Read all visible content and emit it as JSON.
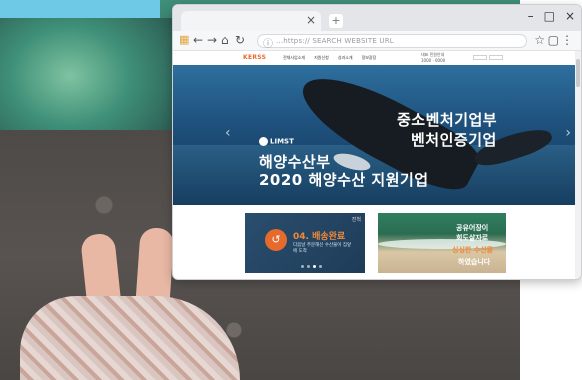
{
  "browser": {
    "tab_close": "×",
    "new_tab": "+",
    "controls": {
      "minimize": "–",
      "restore": "□",
      "close": "×"
    },
    "toolbar": {
      "apps_icon": "apps-grid-icon",
      "back": "←",
      "forward": "→",
      "home": "⌂",
      "reload": "↻",
      "url_lock": "ⓘ",
      "url_text": "...https:// SEARCH WEBSITE URL",
      "star": "☆",
      "document": "▢",
      "menu": "⋮"
    }
  },
  "site": {
    "logo": "KERSS",
    "nav": [
      "전체사업소개",
      "지원신청",
      "성과소개",
      "정보광장"
    ],
    "util": [
      "대표 민원안내",
      "1000 · 0000"
    ],
    "hero": {
      "arrow_left": "‹",
      "arrow_right": "›",
      "brand": "LIMST",
      "line1": "해양수산부",
      "line2": "2020 해양수산 지원기업",
      "right1": "중소벤처기업부",
      "right2": "벤처인증기업"
    }
  },
  "cards": {
    "card1": {
      "tag": "진척",
      "icon": "↺",
      "title": "04. 배송완료",
      "sub": "다음날 주문해신 수산물이 집앞에 도착"
    },
    "card2": {
      "l1": "공유어장이",
      "l2": "회도살자로",
      "l3": "싱싱한 수산물",
      "l4": "하였습니다"
    }
  },
  "colors": {
    "accent": "#e56a2b",
    "hero_blue": "#1d4f7a",
    "window_chrome": "#e4e5e9"
  }
}
